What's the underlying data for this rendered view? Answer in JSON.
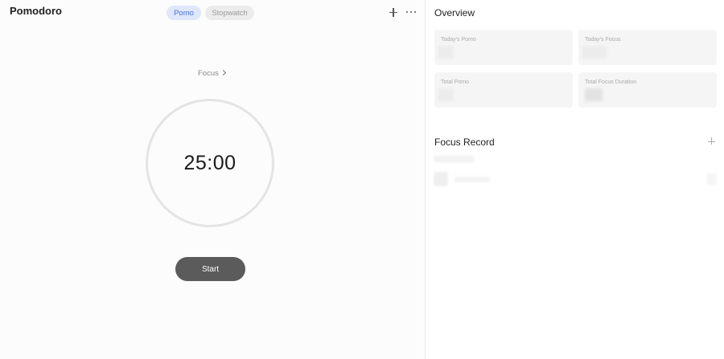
{
  "app": {
    "title": "Pomodoro"
  },
  "mode_tabs": [
    {
      "label": "Pomo",
      "active": true
    },
    {
      "label": "Stopwatch",
      "active": false
    }
  ],
  "header_icons": [
    "plus-icon",
    "more-icon"
  ],
  "timer": {
    "focus_label": "Focus",
    "time": "25:00",
    "start_label": "Start"
  },
  "overview": {
    "title": "Overview",
    "cards": [
      {
        "label": "Today's Pomo"
      },
      {
        "label": "Today's Focus"
      },
      {
        "label": "Total Pomo"
      },
      {
        "label": "Total Focus Duration"
      }
    ]
  },
  "focus_record": {
    "title": "Focus Record"
  },
  "colors": {
    "accent": "#4a73e0",
    "accent_bg": "#dfe7fb",
    "start_button": "#5b5b5b"
  }
}
